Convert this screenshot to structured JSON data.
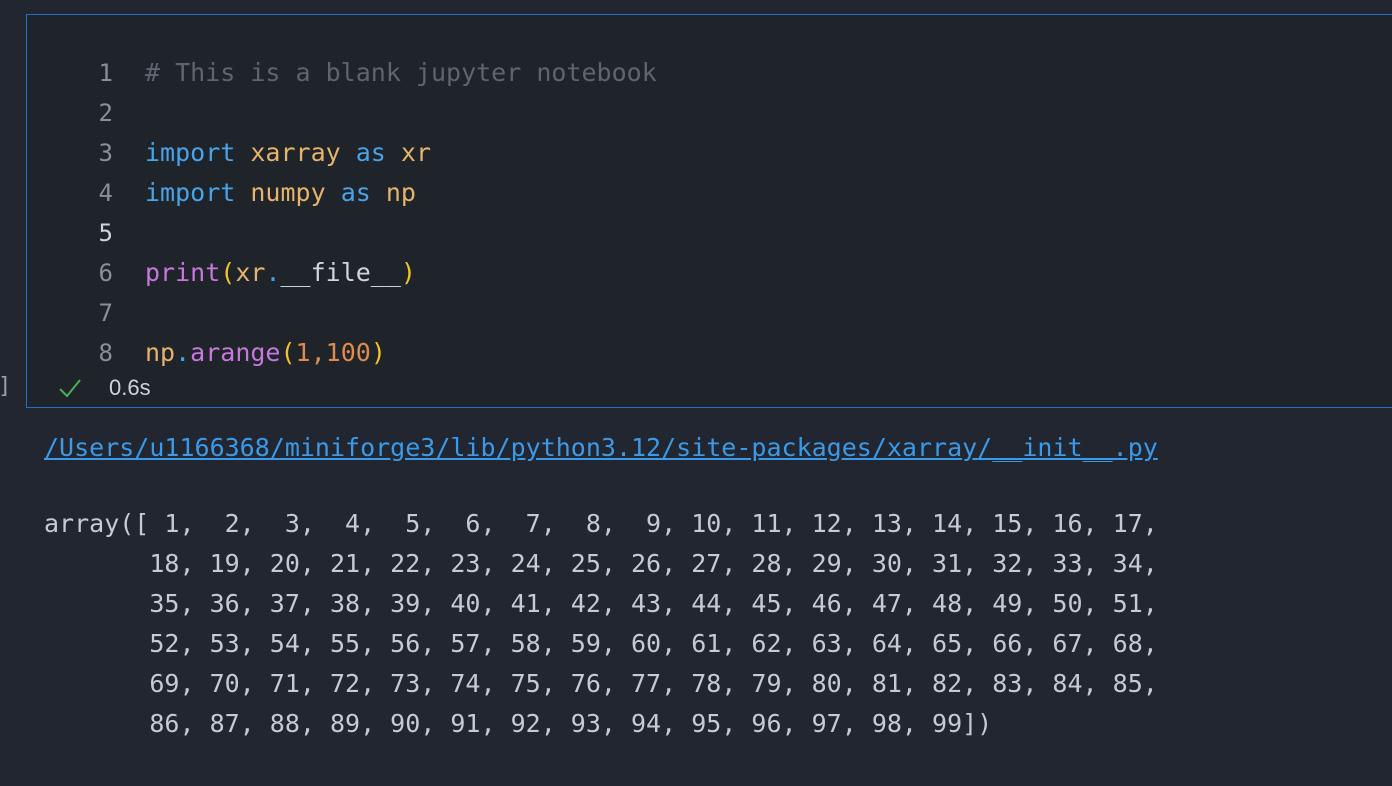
{
  "cell": {
    "lines": [
      {
        "number": "1",
        "tokens": [
          {
            "cls": "tok-comment",
            "text": "# This is a blank jupyter notebook"
          }
        ]
      },
      {
        "number": "2",
        "tokens": []
      },
      {
        "number": "3",
        "tokens": [
          {
            "cls": "tok-keyword",
            "text": "import"
          },
          {
            "cls": "",
            "text": " "
          },
          {
            "cls": "tok-module",
            "text": "xarray"
          },
          {
            "cls": "",
            "text": " "
          },
          {
            "cls": "tok-keyword",
            "text": "as"
          },
          {
            "cls": "",
            "text": " "
          },
          {
            "cls": "tok-module",
            "text": "xr"
          }
        ]
      },
      {
        "number": "4",
        "tokens": [
          {
            "cls": "tok-keyword",
            "text": "import"
          },
          {
            "cls": "",
            "text": " "
          },
          {
            "cls": "tok-module",
            "text": "numpy"
          },
          {
            "cls": "",
            "text": " "
          },
          {
            "cls": "tok-keyword",
            "text": "as"
          },
          {
            "cls": "",
            "text": " "
          },
          {
            "cls": "tok-module",
            "text": "np"
          }
        ]
      },
      {
        "number": "5",
        "active": true,
        "tokens": []
      },
      {
        "number": "6",
        "tokens": [
          {
            "cls": "tok-builtin",
            "text": "print"
          },
          {
            "cls": "tok-paren",
            "text": "("
          },
          {
            "cls": "tok-module",
            "text": "xr"
          },
          {
            "cls": "tok-dot",
            "text": "."
          },
          {
            "cls": "tok-attr",
            "text": "__file__"
          },
          {
            "cls": "tok-paren",
            "text": ")"
          }
        ]
      },
      {
        "number": "7",
        "tokens": []
      },
      {
        "number": "8",
        "tokens": [
          {
            "cls": "tok-module",
            "text": "np"
          },
          {
            "cls": "tok-dot",
            "text": "."
          },
          {
            "cls": "tok-func",
            "text": "arange"
          },
          {
            "cls": "tok-paren",
            "text": "("
          },
          {
            "cls": "tok-number",
            "text": "1"
          },
          {
            "cls": "tok-punct",
            "text": ","
          },
          {
            "cls": "tok-number",
            "text": "100"
          },
          {
            "cls": "tok-paren",
            "text": ")"
          }
        ]
      }
    ],
    "status": {
      "icon": "check-icon",
      "time": "0.6s",
      "color": "#4caf50"
    },
    "left_marker": "]"
  },
  "output": {
    "file_link": "/Users/u1166368/miniforge3/lib/python3.12/site-packages/xarray/__init__.py",
    "array_text": "array([ 1,  2,  3,  4,  5,  6,  7,  8,  9, 10, 11, 12, 13, 14, 15, 16, 17,\n       18, 19, 20, 21, 22, 23, 24, 25, 26, 27, 28, 29, 30, 31, 32, 33, 34,\n       35, 36, 37, 38, 39, 40, 41, 42, 43, 44, 45, 46, 47, 48, 49, 50, 51,\n       52, 53, 54, 55, 56, 57, 58, 59, 60, 61, 62, 63, 64, 65, 66, 67, 68,\n       69, 70, 71, 72, 73, 74, 75, 76, 77, 78, 79, 80, 81, 82, 83, 84, 85,\n       86, 87, 88, 89, 90, 91, 92, 93, 94, 95, 96, 97, 98, 99])"
  }
}
